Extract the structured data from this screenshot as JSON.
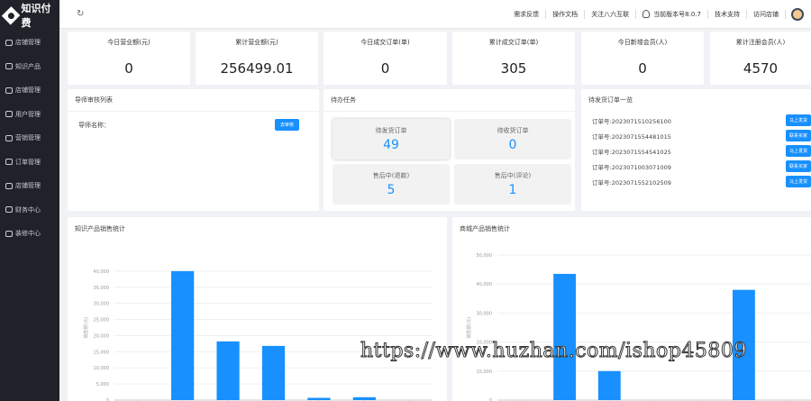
{
  "app": {
    "logo_text": "知识付费"
  },
  "sidebar": {
    "items": [
      {
        "label": "店铺管理"
      },
      {
        "label": "知识产品"
      },
      {
        "label": "店铺管理"
      },
      {
        "label": "用户管理"
      },
      {
        "label": "营销管理"
      },
      {
        "label": "订单管理"
      },
      {
        "label": "店铺管理"
      },
      {
        "label": "财务中心"
      },
      {
        "label": "装修中心"
      }
    ]
  },
  "topbar": {
    "refresh_icon": "↻",
    "links": [
      "需求反馈",
      "操作文档",
      "关注八六互联"
    ],
    "version": "当前版本号8.0.7",
    "support": "技术支持",
    "visit_store": "访问店铺"
  },
  "stats": [
    {
      "label": "今日营业额(元)",
      "value": "0"
    },
    {
      "label": "累计营业额(元)",
      "value": "256499.01"
    },
    {
      "label": "今日成交订单(单)",
      "value": "0"
    },
    {
      "label": "累计成交订单(单)",
      "value": "305"
    },
    {
      "label": "今日新增会员(人)",
      "value": "0"
    },
    {
      "label": "累计注册会员(人)",
      "value": "4570"
    }
  ],
  "quick_panel": {
    "title": "导师审核列表",
    "field_label": "导师名称：",
    "button": "去审核"
  },
  "tasks_panel": {
    "title": "待办任务",
    "tasks": [
      {
        "label": "待发货订单",
        "value": "49"
      },
      {
        "label": "待收货订单",
        "value": "0"
      },
      {
        "label": "售后中(退款)",
        "value": "5"
      },
      {
        "label": "售后中(评论)",
        "value": "1"
      }
    ]
  },
  "orders_panel": {
    "title": "待发货订单一览",
    "orders": [
      {
        "text": "订单号:2023071510256100",
        "button": "马上发货"
      },
      {
        "text": "订单号:2023071554481015",
        "button": "联系买家"
      },
      {
        "text": "订单号:2023071554541025",
        "button": "马上发货"
      },
      {
        "text": "订单号:2023071003071009",
        "button": "联系买家"
      },
      {
        "text": "订单号:2023071552102509",
        "button": "马上发货"
      }
    ]
  },
  "chart_data": [
    {
      "type": "bar",
      "title": "知识产品销售统计",
      "ylabel": "销售额(元)",
      "y_ticks": [
        "0",
        "5,000",
        "10,000",
        "15,000",
        "20,000",
        "25,000",
        "30,000",
        "35,000",
        "40,000"
      ],
      "ylim": [
        0,
        45000
      ],
      "grid": true,
      "values": [
        0,
        40000,
        18200,
        16800,
        700,
        900,
        0
      ],
      "color": "#1890ff"
    },
    {
      "type": "bar",
      "title": "商城产品销售统计",
      "ylabel": "销售额(元)",
      "y_ticks": [
        "0",
        "10,000",
        "20,000",
        "30,000",
        "40,000",
        "50,000"
      ],
      "ylim": [
        0,
        50000
      ],
      "grid": true,
      "values": [
        0,
        43500,
        10000,
        0,
        0,
        38000,
        0
      ],
      "color": "#1890ff"
    }
  ],
  "watermark": "https://www.huzhan.com/ishop45809"
}
